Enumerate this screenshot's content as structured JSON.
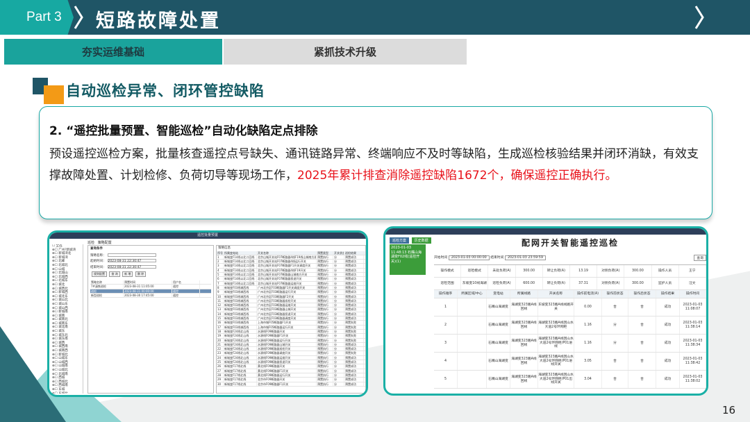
{
  "header": {
    "part_label": "Part 3",
    "title": "短路故障处置",
    "colors": {
      "band": "#1f5566",
      "tab": "#17a9a2"
    }
  },
  "tabs": [
    {
      "label": "夯实运维基础",
      "active": true
    },
    {
      "label": "紧抓技术升级",
      "active": false
    }
  ],
  "section": {
    "title": "自动巡检异常、闭环管控缺陷"
  },
  "textbox": {
    "heading": "2. “遥控批量预置、智能巡检”自动化缺陷定点排除",
    "body_normal": "预设遥控巡检方案，批量核查遥控点号缺失、通讯链路异常、终端响应不及时等缺陷，生成巡检核验结果并闭环消缺，有效支撑故障处置、计划检修、负荷切导等现场工作，",
    "body_highlight": "2025年累计排查消除遥控缺陷1672个，确保遥控正确执行。",
    "highlight_color": "#e8111a"
  },
  "left_screenshot": {
    "title": "遥控批量预置",
    "tabs": [
      "巡检",
      "策略配置"
    ],
    "tree_items": [
      "全选",
      "广州?新城湾",
      "新城湾北",
      "新城湾",
      "北峰",
      "北城北",
      "山城",
      "北城山",
      "北城西",
      "北城东",
      "城北",
      "城西北",
      "新城西",
      "城北东",
      "城山北",
      "城山东",
      "城山西",
      "新城南",
      "城南",
      "城南北",
      "城南东",
      "城北南",
      "城东",
      "城东北",
      "城东南",
      "城西",
      "城西南",
      "城南西",
      "新城北",
      "山城东",
      "山城西",
      "山城南",
      "山城北",
      "北城南",
      "西城",
      "西城北",
      "西城南",
      "东城",
      "东城北",
      "东城南",
      "南城",
      "北城",
      "新城"
    ],
    "query_label": "查询条件",
    "fields": [
      {
        "label": "策略名称：",
        "value": ""
      },
      {
        "label": "起始时间：",
        "value": "2023-08-31 22:30:47"
      },
      {
        "label": "结束时间：",
        "value": "2023-08-31 22:30:47"
      }
    ],
    "buttons": [
      "规则配置",
      "查 询",
      "新 增",
      "删 除"
    ],
    "list_header": [
      "策略名称",
      "预置时间",
      "用户名"
    ],
    "list_rows": [
      [
        "7#滇铁巡检",
        "2023-08-31 11:05:00",
        "遥控"
      ],
      [
        "巡检",
        "2023-08-31 00:00:00",
        "遥控"
      ],
      [
        "新型巡检",
        "2023-08-30 17:45:00",
        "遥控"
      ]
    ],
    "grid_title": "策略信息",
    "grid_header": [
      "序号",
      "所属变电站",
      "开关名称",
      "预置类型",
      "开关状态",
      "巡检结果"
    ],
    "grid_rows": [
      [
        "1",
        "新城变F14线以北二回线",
        "北京山城开关站F07断路器4线F19线山城南方巡线二回线运维开关",
        "预置执行",
        "分",
        "预置成功"
      ],
      [
        "2",
        "新城变F14线以北二回线",
        "北京山城开关站F07断路器4线运行开关",
        "预置执行",
        "分",
        "预置成功"
      ],
      [
        "3",
        "新城变F14线以北二回线",
        "北京山城开关站F07断路器F1开关调度开关",
        "预置执行",
        "分",
        "预置成功"
      ],
      [
        "4",
        "新城变F14线以北二回线",
        "北京山城开关站F07断路器4线F19开关",
        "预置执行",
        "分",
        "预置成功"
      ],
      [
        "5",
        "新城变F14线以北二回线",
        "北京山城开关站F07断路器山城南方开关",
        "预置执行",
        "分",
        "预置成功"
      ],
      [
        "6",
        "新城变F14线以北二回线",
        "北京山城开关站F07断路器投退开关",
        "预置执行",
        "分",
        "预置成功"
      ],
      [
        "7",
        "新城变F14线以北二回线",
        "北京山城开关站F07断路器运维开关",
        "预置执行",
        "分",
        "预置成功"
      ],
      [
        "8",
        "新城变F03线城西线",
        "广州北京区F03断路器F1开关调度开关",
        "预置执行",
        "分",
        "预置成功"
      ],
      [
        "9",
        "新城变F03线城西线",
        "广州北京区F03断路器运行开关",
        "预置执行",
        "分",
        "预置成功"
      ],
      [
        "10",
        "新城变F03线城西线",
        "广州北京区F03断路器F2开关",
        "预置执行",
        "分",
        "预置成功"
      ],
      [
        "11",
        "新城变F03线城西线",
        "广州北京区F03断路器巡检开关",
        "预置执行",
        "分",
        "预置成功"
      ],
      [
        "12",
        "新城变F03线城西线",
        "广州北京区F03断路器运维开关",
        "预置执行",
        "分",
        "预置成功"
      ],
      [
        "13",
        "新城变F03线城西线",
        "广州北京区F03断路器山城开关",
        "预置执行",
        "分",
        "预置成功"
      ],
      [
        "14",
        "新城变F03线城西线",
        "广州北京区F03断路器投退开关",
        "预置执行",
        "分",
        "预置成功"
      ],
      [
        "15",
        "新城变F03线城西线",
        "广州北京区F03断路器调度开关",
        "预置执行",
        "分",
        "预置成功"
      ],
      [
        "16",
        "新城变F03线城西线",
        "上海市城F05断路器F1开关",
        "预置执行",
        "分",
        "预置失败"
      ],
      [
        "17",
        "新城变F03线城西线",
        "上海市城F05断路器运行开关",
        "预置执行",
        "分",
        "预置失败"
      ],
      [
        "18",
        "新城变F24线北山线",
        "水源线F09断路器开关",
        "预置执行",
        "分",
        "预置失败"
      ],
      [
        "19",
        "新城变F24线北山线",
        "水源线F09断路器F1开关",
        "预置执行",
        "分",
        "预置失败"
      ],
      [
        "20",
        "新城变F24线北山线",
        "水源线F09断路器运行开关",
        "预置执行",
        "分",
        "预置失败"
      ],
      [
        "21",
        "新城变F24线北山线",
        "水源线F09断路器山城开关",
        "预置执行",
        "分",
        "预置成功"
      ],
      [
        "22",
        "新城变F24线北山线",
        "水源线F09断路器巡检开关",
        "预置执行",
        "分",
        "预置成功"
      ],
      [
        "23",
        "新城变F24线北山线",
        "水源线F09断路器调度开关",
        "预置执行",
        "分",
        "预置失败"
      ],
      [
        "24",
        "新城变F24线北山线",
        "水源线F09断路器运维开关",
        "预置执行",
        "分",
        "预置成功"
      ],
      [
        "25",
        "新城变F24线北山线",
        "水源线F09断路器投退开关",
        "预置执行",
        "分",
        "预置成功"
      ],
      [
        "26",
        "新城变F17线北线",
        "黄北线F09断路器开关",
        "预置执行",
        "分",
        "预置成功"
      ],
      [
        "27",
        "新城变F17线北线",
        "黄北线F09断路器F1开关",
        "预置执行",
        "分",
        "预置成功"
      ],
      [
        "28",
        "新城变F17线北线",
        "黄北线F09断路器运行开关",
        "预置执行",
        "分",
        "预置成功"
      ],
      [
        "29",
        "新城变F17线北线",
        "北京市F09断路器开关",
        "预置执行",
        "分",
        "预置成功"
      ],
      [
        "30",
        "新城变F17线北线",
        "北京市F09断路器F1开关",
        "预置执行",
        "分",
        "预置成功"
      ]
    ]
  },
  "right_screenshot": {
    "title": "配网开关智能遥控巡检",
    "side_tabs": [
      "巡检方案",
      "历史数据"
    ],
    "side_item": "2023-01-03 11:48:13 石嘴山海湖变F02线(遥控开关)(1)",
    "filter_start_label": "开始时间",
    "filter_start": "2023-01-03 00:00:00",
    "filter_end_label": "结束时间",
    "filter_end": "2023-01-03 23:59:59",
    "query_button": "查询",
    "summary_rows": [
      [
        "操作模式",
        "巡检模式",
        "未处负荷(A)",
        "300.00",
        "转让负荷(A)",
        "13.19",
        "对侧负荷(A)",
        "300.00",
        "操作人员",
        "王宁"
      ],
      [
        "巡检范围",
        "东坡变10线海湖",
        "巡检负荷(A)",
        "600.00",
        "转让负荷(A)",
        "37.31",
        "对侧负荷(A)",
        "300.00",
        "监护人员",
        "汪文"
      ]
    ],
    "table_header": [
      "操作顺序",
      "所属区域/中心",
      "变电站",
      "所属线路",
      "开关名称",
      "操作前电流(A)",
      "操作前状态",
      "操作后状态",
      "操作结果",
      "操作时间"
    ],
    "table_rows": [
      [
        "1",
        "",
        "石嘴山海湖变",
        "海湖变323路A线回线",
        "东坡变323路A线线路开关",
        "0.00",
        "合",
        "合",
        "成功",
        "2023-01-03 11:08:07"
      ],
      [
        "2",
        "",
        "石嘴山海湖变",
        "海湖变323路A线回线",
        "海湖变323路A线回山水大道2号环网柜",
        "1.16",
        "分",
        "合",
        "成功",
        "2023-01-03 11:38:14"
      ],
      [
        "3",
        "",
        "石嘴山海湖变",
        "海湖变323路A线回线",
        "海湖变323路A线回山水大道2号环网柜/P01进线",
        "1.16",
        "分",
        "合",
        "成功",
        "2023-01-03 11:38:34"
      ],
      [
        "4",
        "",
        "石嘴山海湖变",
        "海湖变323路A线回线",
        "海湖变323路A线回山水大道2号环网柜/P01进线开关",
        "3.05",
        "合",
        "合",
        "成功",
        "2023-01-03 11:38:42"
      ],
      [
        "5",
        "",
        "石嘴山海湖变",
        "海湖变323路A线回线",
        "海湖变323路A线回山水大道2号环网柜/P01出线开关",
        "3.04",
        "合",
        "合",
        "成功",
        "2023-01-03 11:38:02"
      ]
    ]
  },
  "page_number": "16"
}
